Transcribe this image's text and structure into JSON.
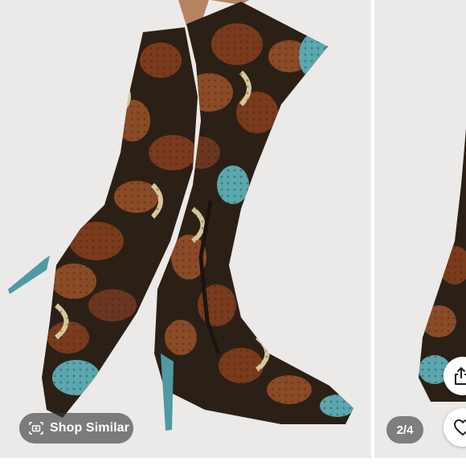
{
  "listing": {
    "photo_alt": "Snakeskin print knee-high stiletto boots",
    "image_counter": "2/4"
  },
  "actions": {
    "shop_similar_label": "Shop Similar",
    "shop_similar_icon": "camera-search-icon",
    "share_icon": "share-icon",
    "like_icon": "heart-icon"
  },
  "colors": {
    "overlay": "#373737",
    "snake_brown": "#7a3a1c",
    "snake_teal": "#5aa7b0",
    "snake_cream": "#d8c79a"
  }
}
